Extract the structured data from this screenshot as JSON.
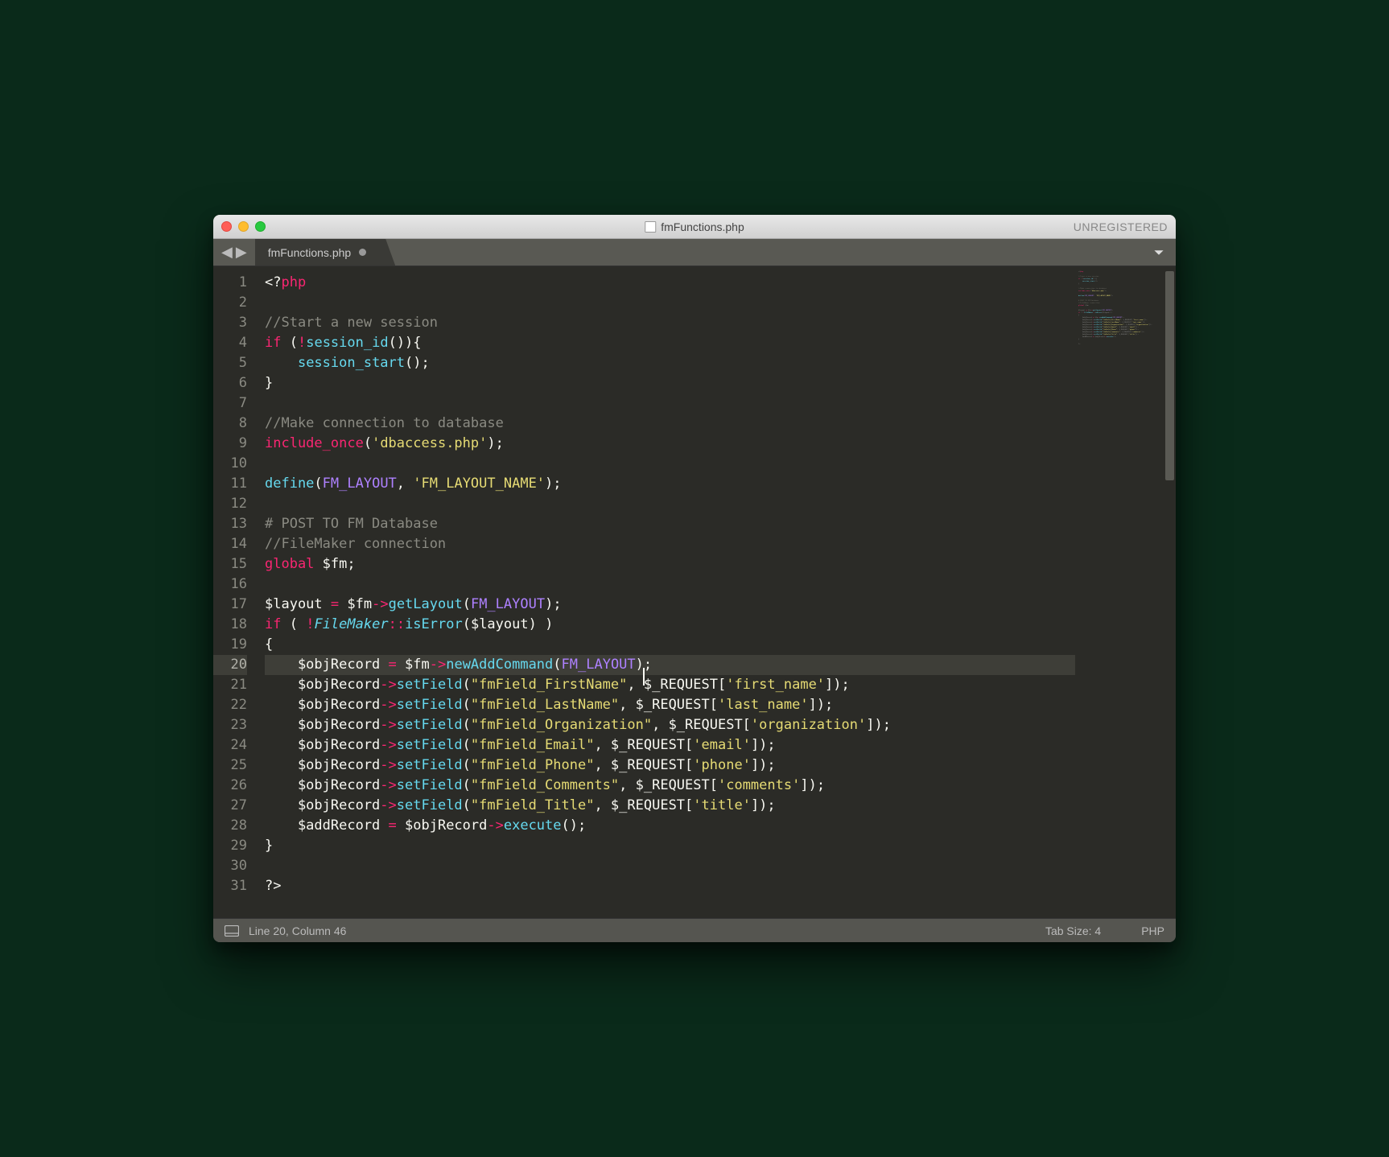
{
  "titlebar": {
    "title": "fmFunctions.php",
    "registration": "UNREGISTERED"
  },
  "tab": {
    "label": "fmFunctions.php"
  },
  "editor": {
    "cursor_line": 20,
    "cursor_col": 46,
    "lines": [
      {
        "n": "1",
        "tokens": [
          [
            "<?",
            "c-default"
          ],
          [
            "php",
            "c-key"
          ]
        ]
      },
      {
        "n": "2",
        "tokens": []
      },
      {
        "n": "3",
        "tokens": [
          [
            "//Start a new session",
            "c-cmt"
          ]
        ]
      },
      {
        "n": "4",
        "tokens": [
          [
            "if",
            "c-key"
          ],
          [
            " (",
            "c-default"
          ],
          [
            "!",
            "c-arrow"
          ],
          [
            "session_id",
            "c-func"
          ],
          [
            "()){",
            "c-default"
          ]
        ]
      },
      {
        "n": "5",
        "tokens": [
          [
            "    ",
            "c-default"
          ],
          [
            "session_start",
            "c-func"
          ],
          [
            "();",
            "c-default"
          ]
        ]
      },
      {
        "n": "6",
        "tokens": [
          [
            "}",
            "c-default"
          ]
        ]
      },
      {
        "n": "7",
        "tokens": []
      },
      {
        "n": "8",
        "tokens": [
          [
            "//Make connection to database",
            "c-cmt"
          ]
        ]
      },
      {
        "n": "9",
        "tokens": [
          [
            "include_once",
            "c-key"
          ],
          [
            "(",
            "c-default"
          ],
          [
            "'dbaccess.php'",
            "c-str"
          ],
          [
            ");",
            "c-default"
          ]
        ]
      },
      {
        "n": "10",
        "tokens": []
      },
      {
        "n": "11",
        "tokens": [
          [
            "define",
            "c-func"
          ],
          [
            "(",
            "c-default"
          ],
          [
            "FM_LAYOUT",
            "c-const"
          ],
          [
            ", ",
            "c-default"
          ],
          [
            "'FM_LAYOUT_NAME'",
            "c-str"
          ],
          [
            ");",
            "c-default"
          ]
        ]
      },
      {
        "n": "12",
        "tokens": []
      },
      {
        "n": "13",
        "tokens": [
          [
            "# POST TO FM Database",
            "c-cmt"
          ]
        ]
      },
      {
        "n": "14",
        "tokens": [
          [
            "//FileMaker connection",
            "c-cmt"
          ]
        ]
      },
      {
        "n": "15",
        "tokens": [
          [
            "global",
            "c-key"
          ],
          [
            " $fm;",
            "c-default"
          ]
        ]
      },
      {
        "n": "16",
        "tokens": []
      },
      {
        "n": "17",
        "tokens": [
          [
            "$layout ",
            "c-default"
          ],
          [
            "=",
            "c-arrow"
          ],
          [
            " $fm",
            "c-default"
          ],
          [
            "->",
            "c-arrow"
          ],
          [
            "getLayout",
            "c-func"
          ],
          [
            "(",
            "c-default"
          ],
          [
            "FM_LAYOUT",
            "c-const"
          ],
          [
            ");",
            "c-default"
          ]
        ]
      },
      {
        "n": "18",
        "tokens": [
          [
            "if",
            "c-key"
          ],
          [
            " ( ",
            "c-default"
          ],
          [
            "!",
            "c-arrow"
          ],
          [
            "FileMaker",
            "c-funci"
          ],
          [
            "::",
            "c-arrow"
          ],
          [
            "isError",
            "c-func"
          ],
          [
            "($layout) )",
            "c-default"
          ]
        ]
      },
      {
        "n": "19",
        "tokens": [
          [
            "{",
            "c-default"
          ]
        ]
      },
      {
        "n": "20",
        "hl": true,
        "tokens": [
          [
            "    $objRecord ",
            "c-default"
          ],
          [
            "=",
            "c-arrow"
          ],
          [
            " $fm",
            "c-default"
          ],
          [
            "->",
            "c-arrow"
          ],
          [
            "newAddCommand",
            "c-func"
          ],
          [
            "(",
            "c-default"
          ],
          [
            "FM_LAYOUT",
            "c-const"
          ],
          [
            ")",
            "c-default"
          ],
          [
            "__CURSOR__",
            ""
          ],
          [
            ";",
            "c-default"
          ]
        ]
      },
      {
        "n": "21",
        "tokens": [
          [
            "    $objRecord",
            "c-default"
          ],
          [
            "->",
            "c-arrow"
          ],
          [
            "setField",
            "c-func"
          ],
          [
            "(",
            "c-default"
          ],
          [
            "\"fmField_FirstName\"",
            "c-str"
          ],
          [
            ", $_REQUEST[",
            "c-default"
          ],
          [
            "'first_name'",
            "c-str"
          ],
          [
            "]);",
            "c-default"
          ]
        ]
      },
      {
        "n": "22",
        "tokens": [
          [
            "    $objRecord",
            "c-default"
          ],
          [
            "->",
            "c-arrow"
          ],
          [
            "setField",
            "c-func"
          ],
          [
            "(",
            "c-default"
          ],
          [
            "\"fmField_LastName\"",
            "c-str"
          ],
          [
            ", $_REQUEST[",
            "c-default"
          ],
          [
            "'last_name'",
            "c-str"
          ],
          [
            "]);",
            "c-default"
          ]
        ]
      },
      {
        "n": "23",
        "tokens": [
          [
            "    $objRecord",
            "c-default"
          ],
          [
            "->",
            "c-arrow"
          ],
          [
            "setField",
            "c-func"
          ],
          [
            "(",
            "c-default"
          ],
          [
            "\"fmField_Organization\"",
            "c-str"
          ],
          [
            ", $_REQUEST[",
            "c-default"
          ],
          [
            "'organization'",
            "c-str"
          ],
          [
            "]);",
            "c-default"
          ]
        ]
      },
      {
        "n": "24",
        "tokens": [
          [
            "    $objRecord",
            "c-default"
          ],
          [
            "->",
            "c-arrow"
          ],
          [
            "setField",
            "c-func"
          ],
          [
            "(",
            "c-default"
          ],
          [
            "\"fmField_Email\"",
            "c-str"
          ],
          [
            ", $_REQUEST[",
            "c-default"
          ],
          [
            "'email'",
            "c-str"
          ],
          [
            "]);",
            "c-default"
          ]
        ]
      },
      {
        "n": "25",
        "tokens": [
          [
            "    $objRecord",
            "c-default"
          ],
          [
            "->",
            "c-arrow"
          ],
          [
            "setField",
            "c-func"
          ],
          [
            "(",
            "c-default"
          ],
          [
            "\"fmField_Phone\"",
            "c-str"
          ],
          [
            ", $_REQUEST[",
            "c-default"
          ],
          [
            "'phone'",
            "c-str"
          ],
          [
            "]);",
            "c-default"
          ]
        ]
      },
      {
        "n": "26",
        "tokens": [
          [
            "    $objRecord",
            "c-default"
          ],
          [
            "->",
            "c-arrow"
          ],
          [
            "setField",
            "c-func"
          ],
          [
            "(",
            "c-default"
          ],
          [
            "\"fmField_Comments\"",
            "c-str"
          ],
          [
            ", $_REQUEST[",
            "c-default"
          ],
          [
            "'comments'",
            "c-str"
          ],
          [
            "]);",
            "c-default"
          ]
        ]
      },
      {
        "n": "27",
        "tokens": [
          [
            "    $objRecord",
            "c-default"
          ],
          [
            "->",
            "c-arrow"
          ],
          [
            "setField",
            "c-func"
          ],
          [
            "(",
            "c-default"
          ],
          [
            "\"fmField_Title\"",
            "c-str"
          ],
          [
            ", $_REQUEST[",
            "c-default"
          ],
          [
            "'title'",
            "c-str"
          ],
          [
            "]);",
            "c-default"
          ]
        ]
      },
      {
        "n": "28",
        "tokens": [
          [
            "    $addRecord ",
            "c-default"
          ],
          [
            "=",
            "c-arrow"
          ],
          [
            " $objRecord",
            "c-default"
          ],
          [
            "->",
            "c-arrow"
          ],
          [
            "execute",
            "c-func"
          ],
          [
            "();",
            "c-default"
          ]
        ]
      },
      {
        "n": "29",
        "tokens": [
          [
            "}",
            "c-default"
          ]
        ]
      },
      {
        "n": "30",
        "tokens": []
      },
      {
        "n": "31",
        "tokens": [
          [
            "?>",
            "c-default"
          ]
        ]
      }
    ]
  },
  "statusbar": {
    "position": "Line 20, Column 46",
    "tabsize": "Tab Size: 4",
    "language": "PHP"
  }
}
